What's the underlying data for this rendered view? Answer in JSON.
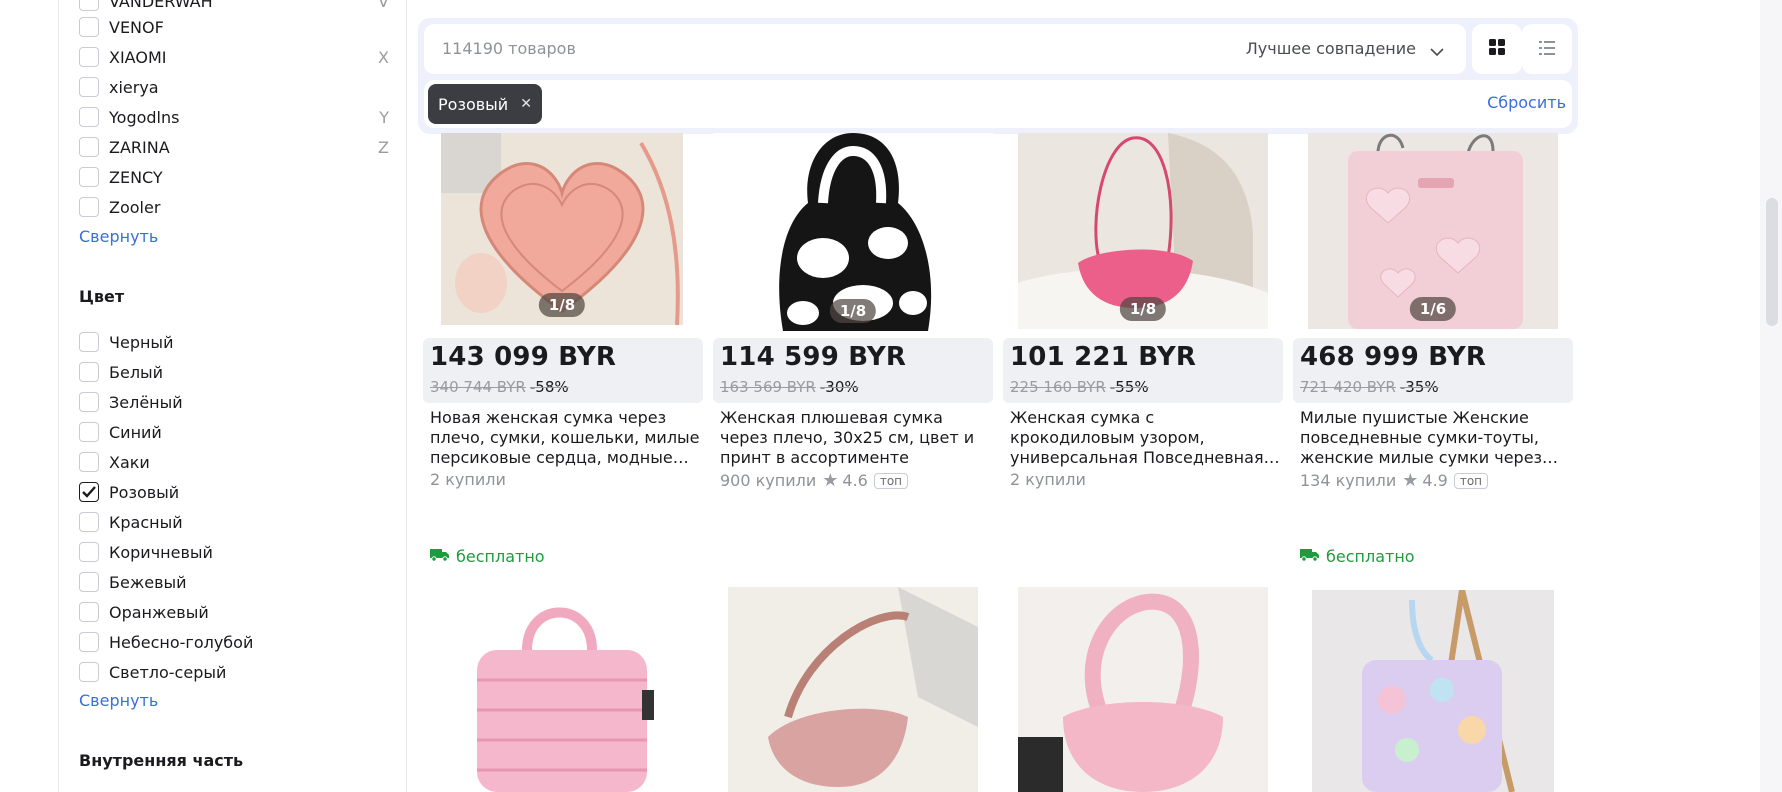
{
  "sidebar": {
    "brands_partial_top": "VANDERWAH",
    "brands": [
      {
        "label": "VENOF",
        "letter": "",
        "checked": false
      },
      {
        "label": "XIAOMI",
        "letter": "X",
        "checked": false
      },
      {
        "label": "xierya",
        "letter": "",
        "checked": false
      },
      {
        "label": "Yogodlns",
        "letter": "Y",
        "checked": false
      },
      {
        "label": "ZARINA",
        "letter": "Z",
        "checked": false
      },
      {
        "label": "ZENCY",
        "letter": "",
        "checked": false
      },
      {
        "label": "Zooler",
        "letter": "",
        "checked": false
      }
    ],
    "collapse_label": "Свернуть",
    "color_section_title": "Цвет",
    "colors": [
      {
        "label": "Черный",
        "checked": false
      },
      {
        "label": "Белый",
        "checked": false
      },
      {
        "label": "Зелёный",
        "checked": false
      },
      {
        "label": "Синий",
        "checked": false
      },
      {
        "label": "Хаки",
        "checked": false
      },
      {
        "label": "Розовый",
        "checked": true
      },
      {
        "label": "Красный",
        "checked": false
      },
      {
        "label": "Коричневый",
        "checked": false
      },
      {
        "label": "Бежевый",
        "checked": false
      },
      {
        "label": "Оранжевый",
        "checked": false
      },
      {
        "label": "Небесно-голубой",
        "checked": false
      },
      {
        "label": "Светло-серый",
        "checked": false
      }
    ],
    "color_collapse_label": "Свернуть",
    "inner_section_title": "Внутренняя часть"
  },
  "toolbar": {
    "count_text": "114190 товаров",
    "sort_label": "Лучшее совпадение",
    "grid_view_icon": "grid-icon",
    "list_view_icon": "list-icon",
    "chip_label": "Розовый",
    "reset_label": "Сбросить"
  },
  "products": [
    {
      "photo_counter": "1/8",
      "price": "143 099 BYR",
      "old_price": "340 744 BYR",
      "discount": "-58%",
      "title": "Новая женская сумка через плечо, сумки, кошельки, милые персиковые сердца, модные…",
      "bought": "2 купили",
      "rating": "",
      "top": ""
    },
    {
      "photo_counter": "1/8",
      "price": "114 599 BYR",
      "old_price": "163 569 BYR",
      "discount": "-30%",
      "title": "Женская плюшевая сумка через плечо, 30x25 см, цвет и принт в ассортименте",
      "bought": "900 купили",
      "rating": "4.6",
      "top": "топ"
    },
    {
      "photo_counter": "1/8",
      "price": "101 221 BYR",
      "old_price": "225 160 BYR",
      "discount": "-55%",
      "title": "Женская сумка с крокодиловым узором, универсальная Повседневная…",
      "bought": "2 купили",
      "rating": "",
      "top": ""
    },
    {
      "photo_counter": "1/6",
      "price": "468 999 BYR",
      "old_price": "721 420 BYR",
      "discount": "-35%",
      "title": "Милые пушистые Женские повседневные сумки-тоуты, женские милые сумки через…",
      "bought": "134 купили",
      "rating": "4.9",
      "top": "топ"
    }
  ],
  "free_shipping_label": "бесплатно",
  "colors": {
    "accent_link": "#3a6fd8",
    "free_shipping": "#1f9a3e",
    "chip_bg": "#3c3d42"
  }
}
